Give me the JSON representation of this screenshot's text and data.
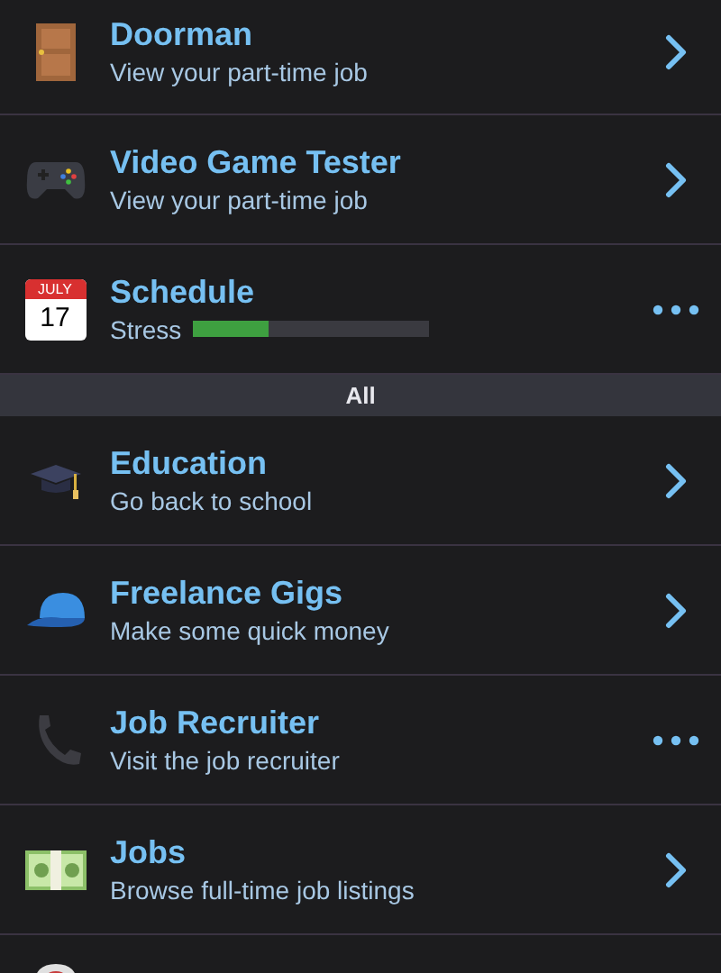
{
  "sections": [
    {
      "items": [
        {
          "title": "Doorman",
          "kind": "subtitle",
          "subtitle": "View your part-time job",
          "more_menu": false
        },
        {
          "title": "Video Game Tester",
          "kind": "subtitle",
          "subtitle": "View your part-time job",
          "more_menu": false
        },
        {
          "title": "Schedule",
          "kind": "meter",
          "meter_label": "Stress",
          "level": 0.32,
          "more_menu": true,
          "calendar_month": "JULY",
          "calendar_day": "17"
        }
      ]
    },
    {
      "header": "All",
      "items": [
        {
          "title": "Education",
          "kind": "subtitle",
          "subtitle": "Go back to school",
          "more_menu": false
        },
        {
          "title": "Freelance Gigs",
          "kind": "subtitle",
          "subtitle": "Make some quick money",
          "more_menu": false
        },
        {
          "title": "Job Recruiter",
          "kind": "subtitle",
          "subtitle": "Visit the job recruiter",
          "more_menu": true
        },
        {
          "title": "Jobs",
          "kind": "subtitle",
          "subtitle": "Browse full-time job listings",
          "more_menu": false
        },
        {
          "kind": "partial"
        }
      ]
    }
  ]
}
